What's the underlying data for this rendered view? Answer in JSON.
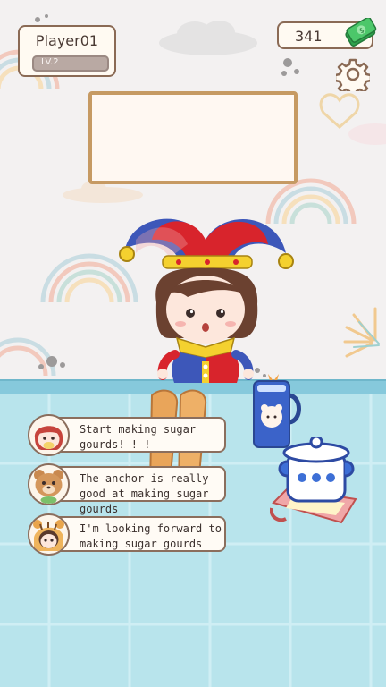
{
  "player": {
    "name": "Player01",
    "level": "LV.2",
    "level_progress": 0
  },
  "currency": {
    "amount": "341",
    "icon": "cash-icon"
  },
  "settings": {
    "icon": "gear-icon"
  },
  "sign": {
    "text": ""
  },
  "chat": [
    {
      "avatar": "girl-avatar",
      "text": "Start making sugar gourds! ! !"
    },
    {
      "avatar": "bear-avatar",
      "text": "The anchor is really good at making sugar gourds"
    },
    {
      "avatar": "tiger-hood-avatar",
      "text": "I'm looking forward to making sugar gourds"
    }
  ],
  "colors": {
    "wall": "#f3f1f1",
    "floor": "#b8e4ec",
    "frame": "#8a6a55",
    "money_green": "#3cb95a"
  }
}
